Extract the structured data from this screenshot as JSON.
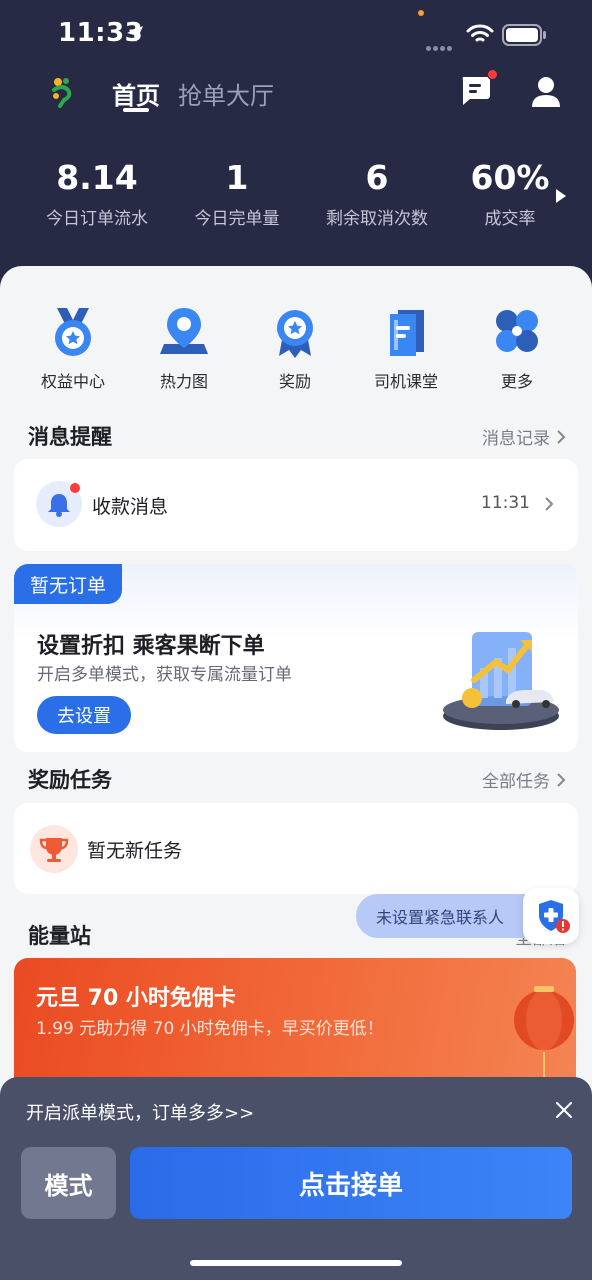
{
  "status_bar": {
    "time": "11:33"
  },
  "nav": {
    "tab_home": "首页",
    "tab_hall": "抢单大厅"
  },
  "stats": [
    {
      "value": "8.14",
      "label": "今日订单流水"
    },
    {
      "value": "1",
      "label": "今日完单量"
    },
    {
      "value": "6",
      "label": "剩余取消次数"
    },
    {
      "value": "60%",
      "label": "成交率"
    }
  ],
  "quick_actions": [
    {
      "label": "权益中心",
      "icon": "medal-icon"
    },
    {
      "label": "热力图",
      "icon": "map-pin-icon"
    },
    {
      "label": "奖励",
      "icon": "award-icon"
    },
    {
      "label": "司机课堂",
      "icon": "book-icon"
    },
    {
      "label": "更多",
      "icon": "more-icon"
    }
  ],
  "messages": {
    "title": "消息提醒",
    "link": "消息记录",
    "item": {
      "label": "收款消息",
      "time": "11:31"
    }
  },
  "promo": {
    "tag": "暂无订单",
    "title": "设置折扣 乘客果断下单",
    "subtitle": "开启多单模式，获取专属流量订单",
    "button": "去设置"
  },
  "tasks": {
    "title": "奖励任务",
    "link": "全部任务",
    "empty": "暂无新任务"
  },
  "energy": {
    "title": "能量站",
    "link_partial": "全部活",
    "banner_title": "元旦 70 小时免佣卡",
    "banner_sub": "1.99 元助力得 70 小时免佣卡，早买价更低！"
  },
  "emergency": {
    "label": "未设置紧急联系人"
  },
  "bottom": {
    "hint": "开启派单模式，订单多多>>",
    "mode_button": "模式",
    "accept_button": "点击接单"
  },
  "colors": {
    "header_bg": "#272a45",
    "accent_blue": "#2b6fe8",
    "badge_red": "#ff3b3b",
    "banner_orange": "#ea4a22"
  }
}
